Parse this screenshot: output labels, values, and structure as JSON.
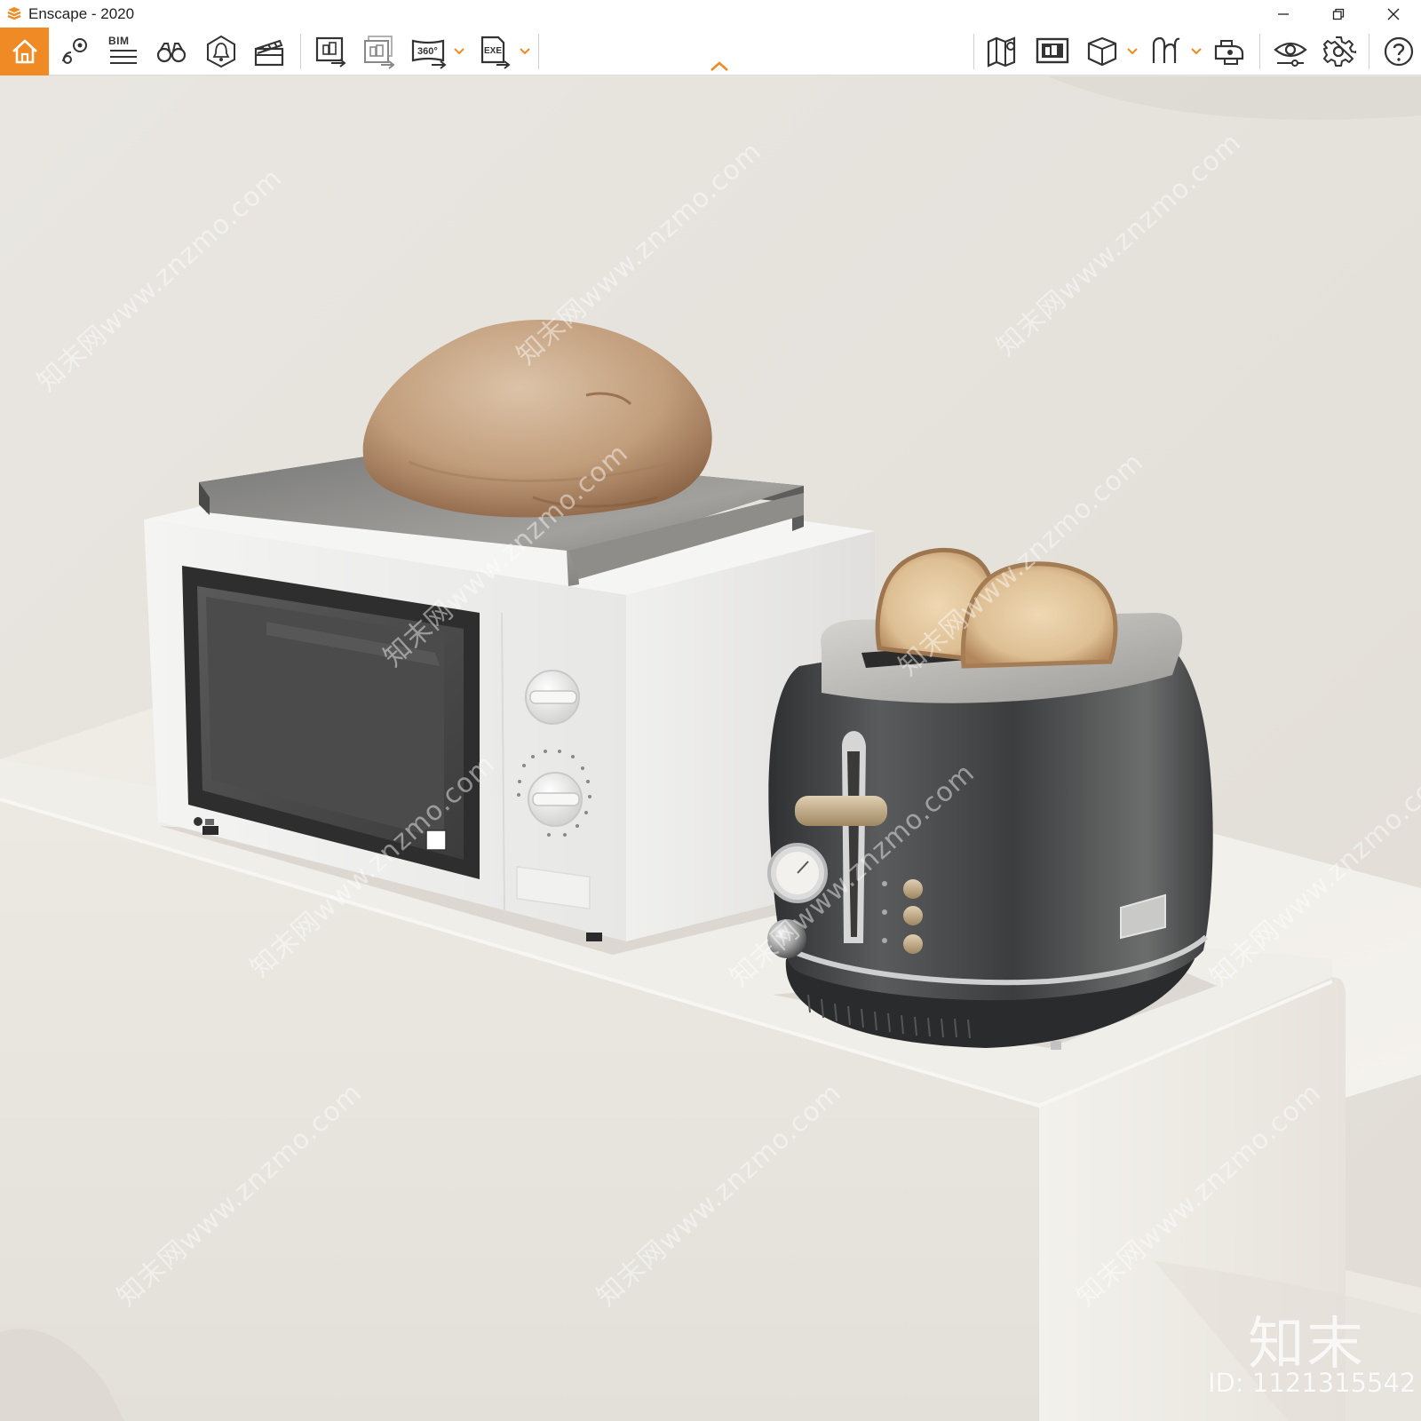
{
  "window": {
    "title": "Enscape - 2020",
    "minimize_icon": "minimize-icon",
    "restore_icon": "restore-icon",
    "close_icon": "close-icon"
  },
  "toolbar": {
    "accent_color": "#f08a24",
    "items": [
      {
        "name": "home",
        "icon": "home-icon"
      },
      {
        "name": "views",
        "icon": "location-pin-icon"
      },
      {
        "name": "bim",
        "icon": "bim-list-icon",
        "label": "BIM"
      },
      {
        "name": "walk-mode",
        "icon": "binoculars-icon"
      },
      {
        "name": "asset-library",
        "icon": "asset-library-icon"
      },
      {
        "name": "video-editor",
        "icon": "clapperboard-icon"
      },
      {
        "name": "screenshot",
        "icon": "screenshot-export-icon"
      },
      {
        "name": "batch-rendering",
        "icon": "batch-rendering-icon"
      },
      {
        "name": "panorama",
        "icon": "panorama-360-icon",
        "label": "360°"
      },
      {
        "name": "export-exe",
        "icon": "exe-export-icon",
        "label": "EXE"
      },
      {
        "name": "map",
        "icon": "map-icon"
      },
      {
        "name": "sync",
        "icon": "sync-views-icon"
      },
      {
        "name": "object",
        "icon": "cube-icon"
      },
      {
        "name": "vr",
        "icon": "vr-headset-icon"
      },
      {
        "name": "capture",
        "icon": "capture-icon"
      },
      {
        "name": "visual-settings",
        "icon": "eye-settings-icon"
      },
      {
        "name": "settings",
        "icon": "gear-icon"
      },
      {
        "name": "help",
        "icon": "help-icon"
      }
    ]
  },
  "viewport": {
    "wall_color": "#e8e5e0",
    "counter_color": "#efece7",
    "watermark_logo": "知末",
    "watermark_id": "ID: 1121315542",
    "watermark_pattern": "知末网www.znzmo.com"
  }
}
